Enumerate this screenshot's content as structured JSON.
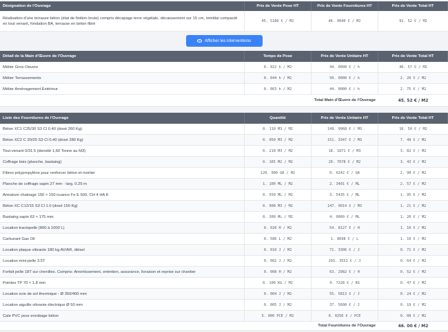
{
  "ouvrage": {
    "headers": [
      "Désignation de l'Ouvrage",
      "Prix de Vente Pose HT",
      "Prix de Vente Fournitures HT",
      "Prix de Vente Total HT"
    ],
    "designation": "Réalisation d'une terrasse béton (état de finition brute) compris décapage terre végétale, décaissement sur 15 cm, remblai compacté en tout venant, fondation BA, terrasse en béton fibré",
    "pose": "45. 5180 € / M2",
    "fournitures": "46. 0040 € / M2",
    "total": "91. 52 € / M2"
  },
  "button": {
    "label": "Afficher les interventions",
    "icon": "eye-icon"
  },
  "main_oeuvre": {
    "headers": [
      "Détail de la Main d'Œuvre de l'Ouvrage",
      "Temps de Pose",
      "Prix de Vente Unitaire HT",
      "Prix de Vente Total HT"
    ],
    "rows": [
      [
        "Métier Gros-Oeuvre",
        "0. 922 h / M2",
        "44. 0000 € / h",
        "40. 57 € / M2"
      ],
      [
        "Métier Terrassements",
        "0. 044 h / M2",
        "50. 0000 € / h",
        "2. 20 € / M2"
      ],
      [
        "Métier Aménagement Extérieur",
        "0. 063 h / M2",
        "44. 0000 € / h",
        "2. 75 € / M2"
      ]
    ],
    "total_label": "Total Main d'Œuvre de l'Ouvrage",
    "total_value": "45. 52 € / M2"
  },
  "fournitures": {
    "headers": [
      "Liste des Fournitures de l'Ouvrage",
      "Quantité",
      "Prix de Vente Unitaire HT",
      "Prix de Vente Total HT"
    ],
    "rows": [
      [
        "Béton XC1 C25/30 S3 Cl 0.40 (dosé 260 Kg)",
        "0. 110 M3 / M2",
        "149. 9968 € / M3",
        "16. 50 € / M2"
      ],
      [
        "Béton XC2 C 20/25 S3 Cl 0.40 (dosé 280 Kg)",
        "0. 050 M3 / M2",
        "151. 3347 € / M3",
        "7. 49 € / M2"
      ],
      [
        "Tout-venant 0/31.5 (densité 1,60 Tonne au M3)",
        "0. 210 M3 / M2",
        "18. 1871 € / M3",
        "3. 82 € / M2"
      ],
      [
        "Coffrage bois (planche, bastaing)",
        "0. 165 M2 / M2",
        "20. 7678 € / M2",
        "3. 43 € / M2"
      ],
      [
        "Fibres polypropylène pour renforcer béton et mortier",
        "120. 000 GR / M2",
        "0. 0242 € / GR",
        "2. 90 € / M2"
      ],
      [
        "Planche de coffrage sapin 27 mm - larg. 0.25 m",
        "1. 100 ML / M2",
        "2. 3401 € / ML",
        "2. 57 € / M2"
      ],
      [
        "Armature chainage 150 × 150 nuance Fe E 500, CH 4 HA 8",
        "0. 550 ML / M2",
        "3. 5435 € / ML",
        "1. 95 € / M2"
      ],
      [
        "Béton XC C12/15 S3 Cl 1.0 (dosé 150 Kg)",
        "0. 008 M3 / M2",
        "147. 9014 € / M3",
        "1. 21 € / M2"
      ],
      [
        "Bastaing sapin 63 × 175 mm",
        "0. 300 ML / M2",
        "4. 0060 € / ML",
        "1. 20 € / M2"
      ],
      [
        "Location tractopelle (800 à 1000 L)",
        "0. 020 H / M2",
        "54. 8127 € / H",
        "1. 10 € / M2"
      ],
      [
        "Carburant Gas Oil",
        "0. 586 L / M2",
        "1. 8698 € / L",
        "1. 10 € / M2"
      ],
      [
        "Location plaque vibrante 180 kg AV/AR, diésel",
        "0. 010 J / M2",
        "71. 3306 € / J",
        "0. 71 € / M2"
      ],
      [
        "Location mini-pelle 3.5T",
        "0. 002 J / M2",
        "293. 3551 € / J",
        "0. 64 € / M2"
      ],
      [
        "Forfait pelle 18T sur chenilles. Compris: Amortissement, entretien, assurance, livraison et reprise sur chantier",
        "0. 008 H / M2",
        "63. 2982 € / H",
        "0. 52 € / M2"
      ],
      [
        "Pointes TP 70 × 1.8 mm",
        "0. 100 KG / M2",
        "4. 7228 € / KG",
        "0. 47 € / M2"
      ],
      [
        "Location scie de sol thermique - Ø 350/400 mm",
        "0. 004 J / M2",
        "55. 5813 € / J",
        "0. 24 € / M2"
      ],
      [
        "Location aiguille vibrante électrique Ø 50 mm",
        "0. 005 J / M2",
        "37. 5600 € / J",
        "0. 19 € / M2"
      ],
      [
        "Cale PVC pour enrobage béton",
        "5. 000 PCE / M2",
        "0. 0256 € / PCE",
        "0. 08 € / M2"
      ]
    ],
    "total_label": "Total Fournitures de l'Ouvrage",
    "total_value": "46. 00 € / M2"
  }
}
